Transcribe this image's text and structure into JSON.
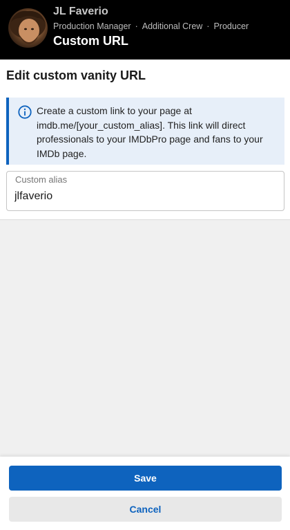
{
  "header": {
    "name": "JL Faverio",
    "roles": [
      "Production Manager",
      "Additional Crew",
      "Producer"
    ],
    "separator": "·",
    "page_title": "Custom URL"
  },
  "section": {
    "title": "Edit custom vanity URL"
  },
  "info": {
    "icon": "info-icon",
    "text": "Create a custom link to your page at imdb.me/[your_custom_alias]. This link will direct professionals to your IMDbPro page and fans to your IMDb page."
  },
  "alias_field": {
    "label": "Custom alias",
    "value": "jlfaverio"
  },
  "actions": {
    "save_label": "Save",
    "cancel_label": "Cancel"
  },
  "colors": {
    "accent": "#0e63be",
    "info_bg": "#e7eff9",
    "header_bg": "#000000"
  }
}
